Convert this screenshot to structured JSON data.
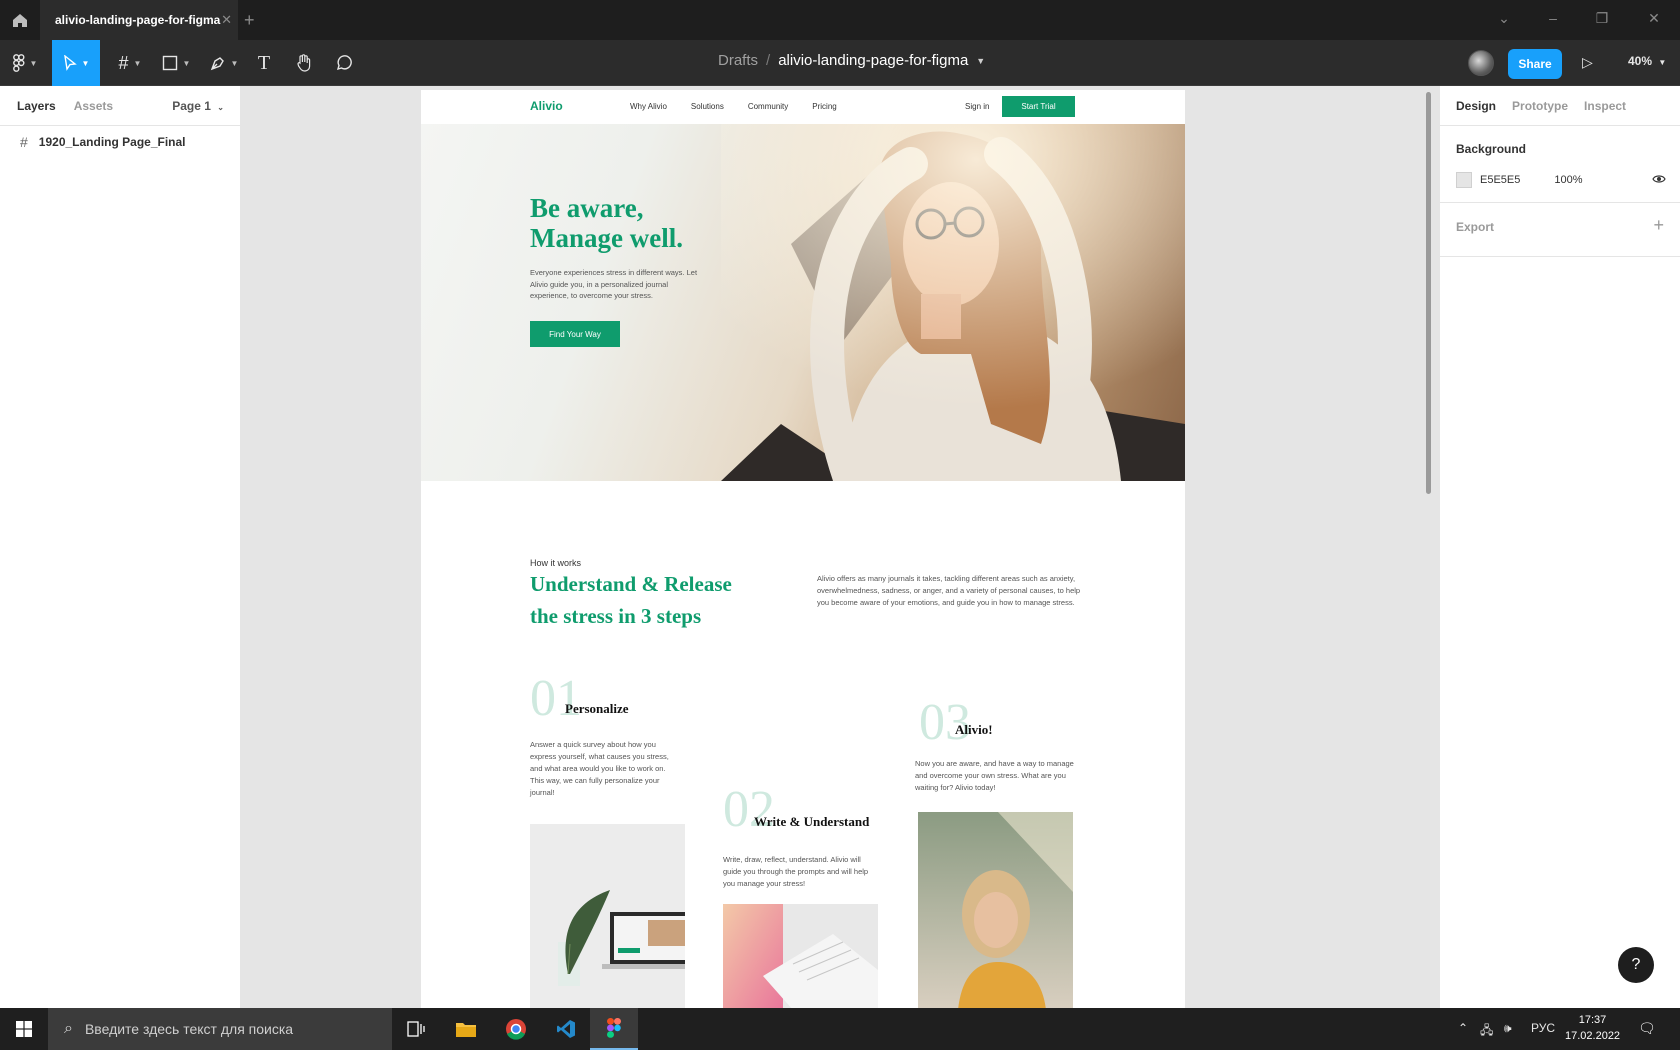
{
  "tab": {
    "title": "alivio-landing-page-for-figma"
  },
  "breadcrumb": {
    "root": "Drafts",
    "sep": "/",
    "file": "alivio-landing-page-for-figma"
  },
  "toolbar": {
    "share_label": "Share",
    "zoom": "40%"
  },
  "layers_panel": {
    "tabs": [
      "Layers",
      "Assets"
    ],
    "page": "Page 1",
    "layers": [
      "1920_Landing Page_Final"
    ]
  },
  "design_panel": {
    "tabs": [
      "Design",
      "Prototype",
      "Inspect"
    ],
    "background_label": "Background",
    "background_hex": "E5E5E5",
    "background_opacity": "100%",
    "export_label": "Export"
  },
  "site": {
    "logo": "Alivio",
    "nav": [
      "Why Alivio",
      "Solutions",
      "Community",
      "Pricing"
    ],
    "signin": "Sign in",
    "trial": "Start Trial",
    "hero_title_1": "Be aware,",
    "hero_title_2": "Manage well.",
    "hero_sub": "Everyone experiences stress in different ways. Let Alivio guide you, in a personalized journal experience, to overcome your stress.",
    "hero_cta": "Find Your Way",
    "how_label": "How it works",
    "how_title_1": "Understand & Release",
    "how_title_2": "the stress in 3 steps",
    "how_desc": "Alivio offers as many journals it takes, tackling different areas such as anxiety, overwhelmedness, sadness, or anger, and a variety of personal causes, to help you become aware of your emotions, and guide you in how to manage stress.",
    "steps": [
      {
        "num": "01",
        "title": "Personalize",
        "desc": "Answer a quick survey about how you express yourself, what causes you stress, and what area would you like to work on. This way, we can fully personalize your journal!"
      },
      {
        "num": "02",
        "title": "Write & Understand",
        "desc": "Write, draw, reflect, understand. Alivio will guide you through the prompts and will help you manage your stress!"
      },
      {
        "num": "03",
        "title": "Alivio!",
        "desc": "Now you are aware, and have a way to manage and overcome your own stress. What are you waiting for? Alivio today!"
      }
    ]
  },
  "taskbar": {
    "search_placeholder": "Введите здесь текст для поиска",
    "lang": "РУС",
    "time": "17:37",
    "date": "17.02.2022"
  },
  "colors": {
    "brand": "#0f9c6d",
    "figma_blue": "#18a0fb",
    "canvas": "#e5e5e5"
  }
}
